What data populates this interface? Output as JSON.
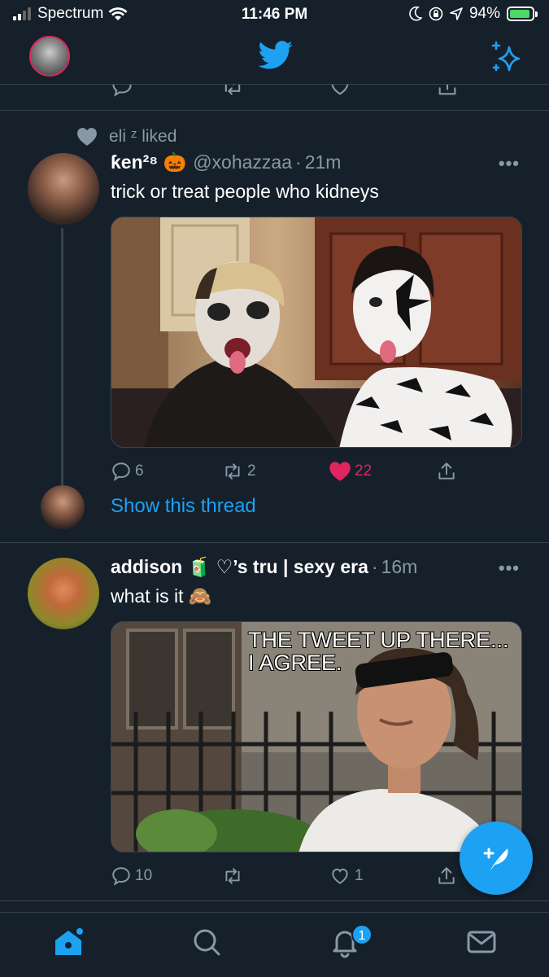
{
  "status_bar": {
    "carrier": "Spectrum",
    "time": "11:46 PM",
    "battery": "94%",
    "battery_level": 0.94
  },
  "header": {
    "logo": "twitter-bird-icon",
    "action": "sparkle-icon"
  },
  "tweets": [
    {
      "social_context": "eli ᶻ liked",
      "name": "ƙen²⁸ 🎃",
      "handle": "@xohazzaa",
      "time": "21m",
      "text": "trick or treat people who kidneys",
      "replies": "6",
      "retweets": "2",
      "likes": "22",
      "liked": true,
      "show_thread": "Show this thread"
    },
    {
      "name": "addison 🧃 ♡’s tru | sexy era",
      "time": "16m",
      "text": "what is it 🙈",
      "meme_text_line1": "THE TWEET UP THERE...",
      "meme_text_line2": "I AGREE.",
      "replies": "10",
      "retweets": "",
      "likes": "1"
    }
  ],
  "tabbar": {
    "notifications_badge": "1"
  },
  "colors": {
    "background": "#15202b",
    "accent": "#1da1f2",
    "like": "#e0245e",
    "muted": "#8899a6",
    "border": "#38444d"
  }
}
